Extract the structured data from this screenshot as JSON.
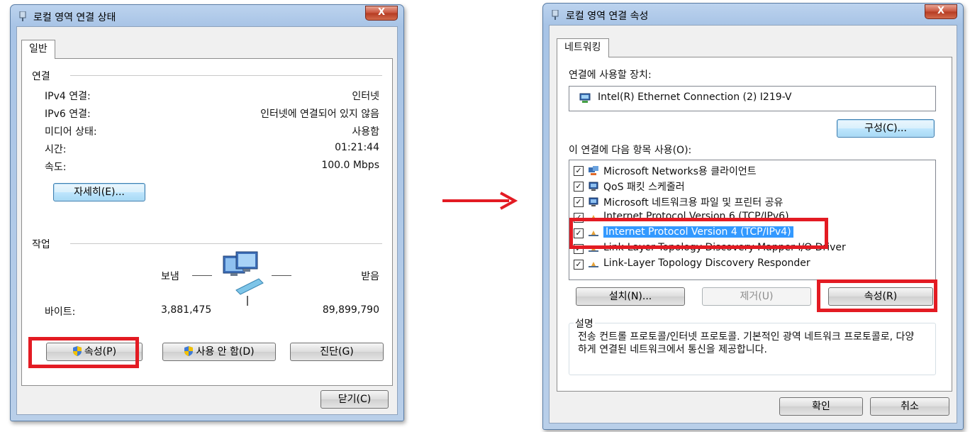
{
  "status_window": {
    "title": "로컬 영역 연결 상태",
    "close_label": "X",
    "tab_general": "일반",
    "connection_group": "연결",
    "rows": [
      {
        "label": "IPv4 연결:",
        "value": "인터넷"
      },
      {
        "label": "IPv6 연결:",
        "value": "인터넷에 연결되어 있지 않음"
      },
      {
        "label": "미디어 상태:",
        "value": "사용함"
      },
      {
        "label": "시간:",
        "value": "01:21:44"
      },
      {
        "label": "속도:",
        "value": "100.0 Mbps"
      }
    ],
    "details_button": "자세히(E)...",
    "activity_group": "작업",
    "sent_label": "보냄",
    "received_label": "받음",
    "bytes_label": "바이트:",
    "bytes_sent": "3,881,475",
    "bytes_received": "89,899,790",
    "properties_button": "속성(P)",
    "disable_button": "사용 안 함(D)",
    "diagnose_button": "진단(G)",
    "close_button": "닫기(C)"
  },
  "properties_window": {
    "title": "로컬 영역 연결 속성",
    "close_label": "X",
    "tab_networking": "네트워킹",
    "connect_using_label": "연결에 사용할 장치:",
    "adapter_name": "Intel(R) Ethernet Connection (2) I219-V",
    "configure_button": "구성(C)...",
    "items_label": "이 연결에 다음 항목 사용(O):",
    "items": [
      {
        "label": "Microsoft Networks용 클라이언트",
        "checked": true,
        "icon": "network-client-icon"
      },
      {
        "label": "QoS 패킷 스케줄러",
        "checked": true,
        "icon": "qos-icon"
      },
      {
        "label": "Microsoft 네트워크용 파일 및 프린터 공유",
        "checked": true,
        "icon": "file-share-icon"
      },
      {
        "label": "Internet Protocol Version 6 (TCP/IPv6)",
        "checked": true,
        "icon": "protocol-icon"
      },
      {
        "label": "Internet Protocol Version 4 (TCP/IPv4)",
        "checked": true,
        "icon": "protocol-icon",
        "selected": true
      },
      {
        "label": "Link-Layer Topology Discovery Mapper I/O Driver",
        "checked": true,
        "icon": "protocol-icon"
      },
      {
        "label": "Link-Layer Topology Discovery Responder",
        "checked": true,
        "icon": "protocol-icon"
      }
    ],
    "install_button": "설치(N)...",
    "uninstall_button": "제거(U)",
    "properties_button": "속성(R)",
    "description_group": "설명",
    "description_text": "전송 컨트롤 프로토콜/인터넷 프로토콜. 기본적인 광역 네트워크 프로토콜로, 다양하게 연결된 네트워크에서 통신을 제공합니다.",
    "ok_button": "확인",
    "cancel_button": "취소"
  },
  "colors": {
    "highlight": "#e31b23",
    "selection": "#3399ff",
    "arrow": "#e31b23"
  }
}
